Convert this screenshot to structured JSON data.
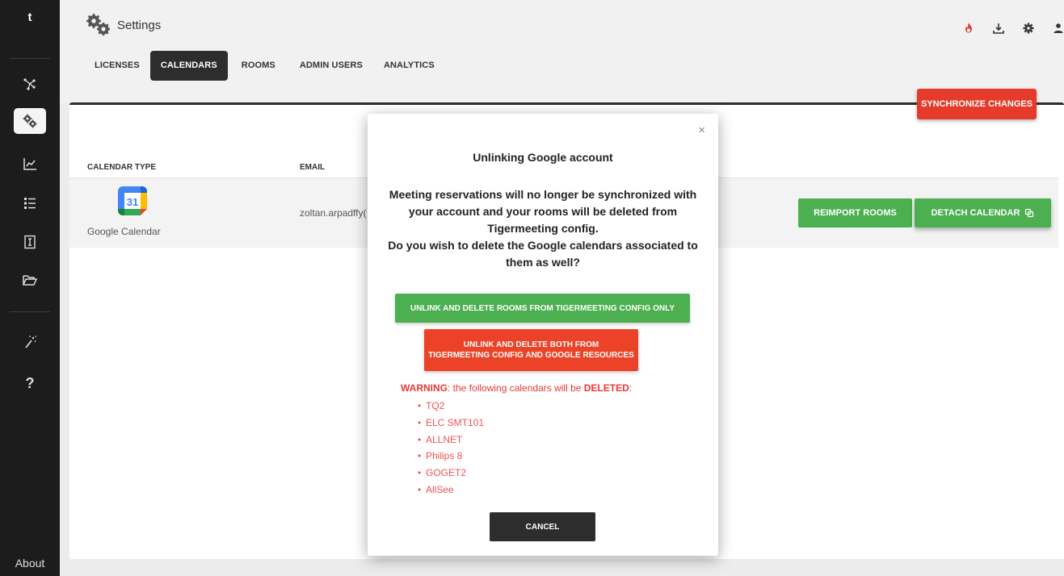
{
  "app": {
    "logo_letter": "t",
    "page_title": "Settings",
    "about_label": "About"
  },
  "sidebar": {
    "items": [
      {
        "icon": "network-icon",
        "active": false
      },
      {
        "icon": "gears-icon",
        "active": true
      },
      {
        "icon": "chart-icon",
        "active": false
      },
      {
        "icon": "list-icon",
        "active": false
      },
      {
        "icon": "document-icon",
        "active": false
      },
      {
        "icon": "folder-icon",
        "active": false
      },
      {
        "icon": "magic-wand-icon",
        "active": false
      },
      {
        "icon": "help-icon",
        "active": false
      }
    ]
  },
  "tabs": [
    {
      "label": "LICENSES",
      "active": false
    },
    {
      "label": "CALENDARS",
      "active": true
    },
    {
      "label": "ROOMS",
      "active": false
    },
    {
      "label": "ADMIN USERS",
      "active": false
    },
    {
      "label": "ANALYTICS",
      "active": false
    }
  ],
  "header_icons": [
    "fire-icon",
    "download-icon",
    "gear-icon",
    "user-icon"
  ],
  "sync_button": "SYNCHRONIZE CHANGES",
  "table": {
    "headers": {
      "calendar_type": "CALENDAR TYPE",
      "email": "EMAIL"
    },
    "row": {
      "calendar_type": "Google Calendar",
      "logo_day": "31",
      "email": "zoltan.arpadffy(",
      "reimport_label": "REIMPORT ROOMS",
      "detach_label": "DETACH CALENDAR"
    }
  },
  "modal": {
    "close": "×",
    "title": "Unlinking Google account",
    "message_line1": "Meeting reservations will no longer be synchronized with your account and your rooms will be deleted from Tigermeeting config.",
    "message_line2": "Do you wish to delete the Google calendars associated to them as well?",
    "unlink_config_label": "UNLINK AND DELETE ROOMS FROM TIGERMEETING CONFIG ONLY",
    "unlink_both_line1": "UNLINK AND DELETE BOTH FROM",
    "unlink_both_line2": "TIGERMEETING CONFIG AND GOOGLE RESOURCES",
    "warning_prefix": "WARNING",
    "warning_mid": ": the following calendars will be ",
    "warning_deleted": "DELETED",
    "warning_suffix": ":",
    "calendars": [
      "TQ2",
      "ELC SMT101",
      "ALLNET",
      "Philips 8",
      "GOGET2",
      "AllSee"
    ],
    "cancel_label": "CANCEL"
  },
  "colors": {
    "sidebar_bg": "#1c1c1c",
    "accent_dark": "#2d2d2d",
    "green": "#4caf50",
    "red": "#e53b2a",
    "warning_red": "#e53935",
    "fire_red": "#e53935"
  }
}
